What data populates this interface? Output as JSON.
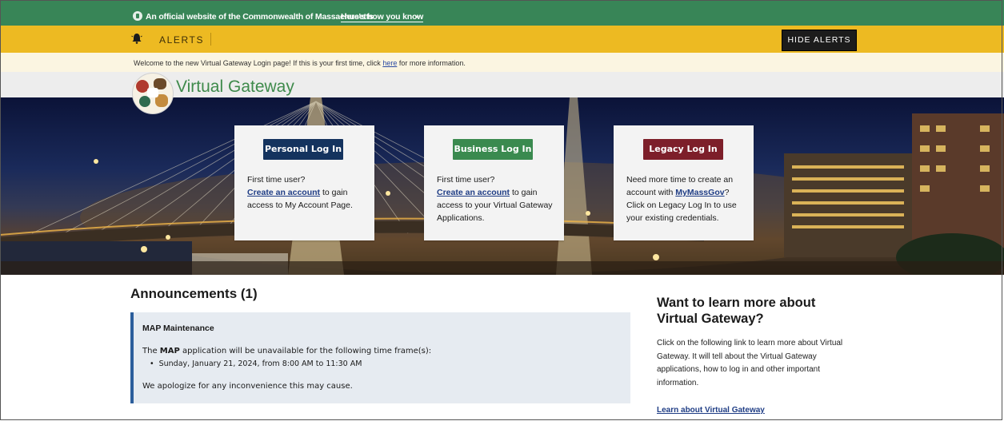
{
  "official_banner": {
    "text": "An official website of the Commonwealth of Massachusetts",
    "how_link": "Here's how you know"
  },
  "alerts": {
    "label": "ALERTS",
    "hide_button": "HIDE ALERTS"
  },
  "welcome": {
    "before": "Welcome to the new Virtual Gateway Login page! If this is your first time, click ",
    "link": "here",
    "after": " for more information."
  },
  "brand": {
    "title": "Virtual Gateway"
  },
  "cards": [
    {
      "button": "Personal Log In",
      "color": "#14335e",
      "lines": {
        "a": "First time user?",
        "link": "Create an account",
        "b": " to gain access to My Account Page."
      }
    },
    {
      "button": "Business Log In",
      "color": "#3a8a4f",
      "lines": {
        "a": "First time user?",
        "link": "Create an account",
        "b": " to gain access to your Virtual Gateway Applications."
      }
    },
    {
      "button": "Legacy Log In",
      "color": "#7d1f2a",
      "lines": {
        "a": "Need more time to create an account with ",
        "link": "MyMassGov",
        "b": "? Click on Legacy Log In to use your existing credentials."
      }
    }
  ],
  "announcements": {
    "title": "Announcements (1)",
    "item": {
      "heading": "MAP Maintenance",
      "p_prefix": "The ",
      "p_bold": "MAP",
      "p_suffix": " application will be unavailable for the following time frame(s):",
      "bullet": "Sunday, January 21, 2024, from 8:00 AM to 11:30 AM",
      "closing": "We apologize for any inconvenience this may cause."
    }
  },
  "sidebar": {
    "title": "Want to learn more about Virtual Gateway?",
    "body": "Click on the following link to learn more about Virtual Gateway. It will tell about the Virtual Gateway applications, how to log in and other important information.",
    "link": "Learn about Virtual Gateway"
  },
  "colors": {
    "official_green": "#388557",
    "alert_yellow": "#edba22",
    "brand_green": "#3e8a4b",
    "link_blue": "#1f3d85"
  }
}
